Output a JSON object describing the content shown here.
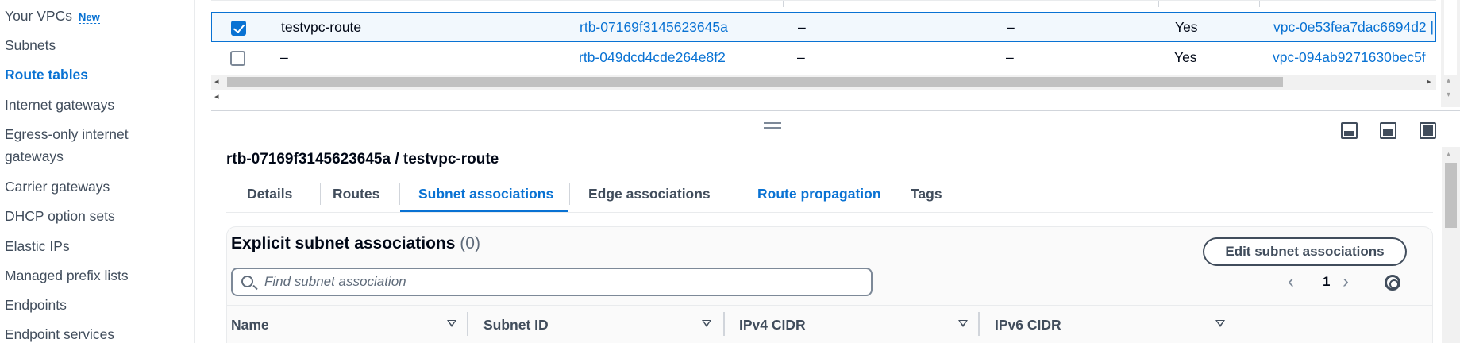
{
  "sidebar": {
    "items": [
      {
        "label": "Your VPCs",
        "badge": "New"
      },
      {
        "label": "Subnets"
      },
      {
        "label": "Route tables"
      },
      {
        "label": "Internet gateways"
      },
      {
        "label": "Egress-only internet"
      },
      {
        "label": "gateways"
      },
      {
        "label": "Carrier gateways"
      },
      {
        "label": "DHCP option sets"
      },
      {
        "label": "Elastic IPs"
      },
      {
        "label": "Managed prefix lists"
      },
      {
        "label": "Endpoints"
      },
      {
        "label": "Endpoint services"
      }
    ]
  },
  "route_tables": {
    "rows": [
      {
        "name": "testvpc-route",
        "id": "rtb-07169f3145623645a",
        "col3": "–",
        "col4": "–",
        "main": "Yes",
        "vpc": "vpc-0e53fea7dac6694d2 |",
        "selected": true
      },
      {
        "name": "–",
        "id": "rtb-049dcd4cde264e8f2",
        "col3": "–",
        "col4": "–",
        "main": "Yes",
        "vpc": "vpc-094ab9271630bec5f",
        "selected": false
      }
    ]
  },
  "details": {
    "title": "rtb-07169f3145623645a / testvpc-route",
    "tabs": [
      {
        "label": "Details"
      },
      {
        "label": "Routes"
      },
      {
        "label": "Subnet associations"
      },
      {
        "label": "Edge associations"
      },
      {
        "label": "Route propagation"
      },
      {
        "label": "Tags"
      }
    ],
    "active_tab": "Subnet associations"
  },
  "explicit_associations": {
    "title": "Explicit subnet associations",
    "count": "(0)",
    "edit_button": "Edit subnet associations",
    "search_placeholder": "Find subnet association",
    "page": "1",
    "columns": [
      "Name",
      "Subnet ID",
      "IPv4 CIDR",
      "IPv6 CIDR"
    ]
  },
  "colors": {
    "link": "#0972d3",
    "selected_row_bg": "#f2f8fd",
    "text": "#000716",
    "secondary_text": "#414d5c"
  }
}
